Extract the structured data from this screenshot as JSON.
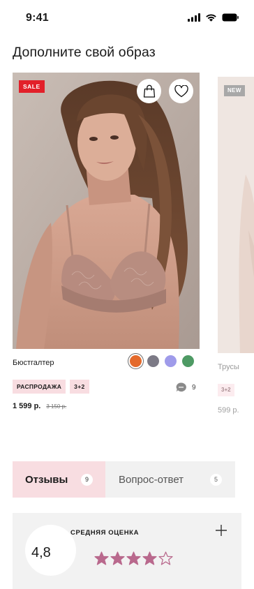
{
  "status_bar": {
    "time": "9:41"
  },
  "section": {
    "title": "Дополните свой образ"
  },
  "product_main": {
    "badge": "SALE",
    "name": "Бюстгалтер",
    "swatches": [
      "#e46a2c",
      "#7c7a86",
      "#9f9bea",
      "#4e9a64"
    ],
    "selected_swatch": 0,
    "tags": [
      "РАСПРОДАЖА",
      "3+2"
    ],
    "comments_count": "9",
    "price": "1 599 р.",
    "old_price": "3 150 р."
  },
  "product_peek": {
    "badge": "NEW",
    "name": "Трусы",
    "tag": "3+2",
    "price": "599 р."
  },
  "tabs": [
    {
      "label": "Отзывы",
      "count": "9",
      "active": true
    },
    {
      "label": "Вопрос-ответ",
      "count": "5",
      "active": false
    }
  ],
  "rating": {
    "value": "4,8",
    "label": "СРЕДНЯЯ ОЦЕНКА",
    "stars_filled": 4,
    "stars_total": 5,
    "star_color": "#b9698d"
  },
  "colors": {
    "sale": "#e2202a",
    "tag_bg": "#f8dde1",
    "tab_active_bg": "#f8dde1",
    "panel_bg": "#f2f2f2"
  },
  "icons": [
    "signal-icon",
    "wifi-icon",
    "battery-icon",
    "shopping-bag-icon",
    "heart-icon",
    "chat-icon",
    "plus-icon",
    "star-icon"
  ]
}
